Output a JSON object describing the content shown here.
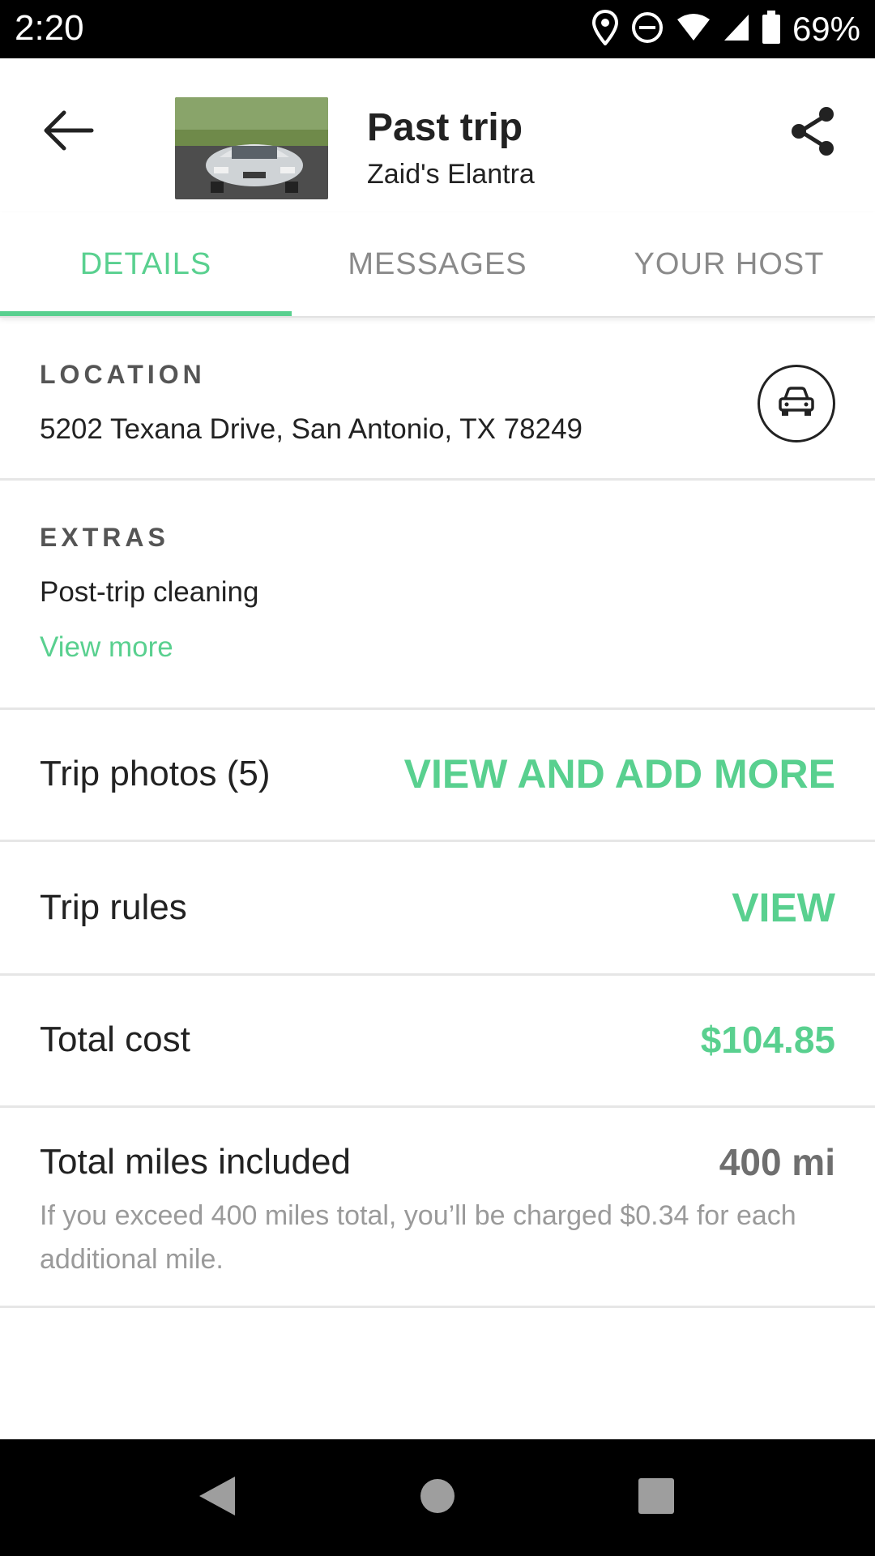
{
  "status_bar": {
    "time": "2:20",
    "battery": "69%",
    "icons": [
      "location-icon",
      "do-not-disturb-icon",
      "wifi-icon",
      "signal-icon",
      "battery-icon"
    ]
  },
  "header": {
    "title": "Past trip",
    "subtitle": "Zaid's Elantra",
    "icons": [
      "back-arrow-icon",
      "share-icon"
    ]
  },
  "tabs": [
    {
      "label": "DETAILS",
      "active": true
    },
    {
      "label": "MESSAGES",
      "active": false
    },
    {
      "label": "YOUR HOST",
      "active": false
    }
  ],
  "location": {
    "label": "LOCATION",
    "address": "5202 Texana Drive, San Antonio, TX 78249",
    "icon": "car-icon"
  },
  "extras": {
    "label": "EXTRAS",
    "item": "Post-trip cleaning",
    "link": "View more"
  },
  "trip_photos": {
    "label": "Trip photos (5)",
    "action": "VIEW AND ADD MORE"
  },
  "trip_rules": {
    "label": "Trip rules",
    "action": "VIEW"
  },
  "total_cost": {
    "label": "Total cost",
    "value": "$104.85"
  },
  "total_miles": {
    "label": "Total miles included",
    "value": "400 mi",
    "note": "If you exceed 400 miles total, you’ll be charged $0.34 for each additional mile."
  },
  "colors": {
    "accent": "#59d08f",
    "text": "#222222",
    "muted": "#9a9a9a",
    "divider": "#e6e6e6"
  },
  "nav_bar": {
    "icons": [
      "nav-back-icon",
      "nav-home-icon",
      "nav-recents-icon"
    ]
  }
}
